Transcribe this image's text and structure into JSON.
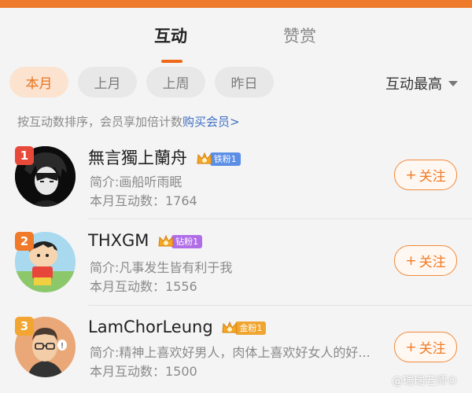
{
  "tabs": [
    {
      "label": "互动",
      "active": true
    },
    {
      "label": "赞赏",
      "active": false
    }
  ],
  "filters": [
    {
      "label": "本月",
      "active": true
    },
    {
      "label": "上月",
      "active": false
    },
    {
      "label": "上周",
      "active": false
    },
    {
      "label": "昨日",
      "active": false
    }
  ],
  "sort": {
    "label": "互动最高",
    "icon": "caret-down-icon"
  },
  "hint": {
    "text": "按互动数排序，会员享加倍计数",
    "link": "购买会员>"
  },
  "follow_label": "关注",
  "users": [
    {
      "rank": "1",
      "rank_color": "#e84a3a",
      "name": "無言獨上蘭舟",
      "fan_label": "铁粉1",
      "fan_color": "#5b8ee6",
      "bio": "简介:画船听雨眠",
      "count": "本月互动数：1764",
      "avatar": "dark-anime-avatar"
    },
    {
      "rank": "2",
      "rank_color": "#f07a2a",
      "name": "THXGM",
      "fan_label": "钻粉1",
      "fan_color": "#b06de8",
      "bio": "简介:凡事发生皆有利于我",
      "count": "本月互动数：1556",
      "avatar": "cartoon-boy-avatar"
    },
    {
      "rank": "3",
      "rank_color": "#f2a530",
      "name": "LamChorLeung",
      "fan_label": "金粉1",
      "fan_color": "#f0a530",
      "bio": "简介:精神上喜欢好男人，肉体上喜欢好女人的好...",
      "count": "本月互动数：1500",
      "avatar": "glasses-man-avatar"
    }
  ],
  "watermark": "@瑞瑞老师©"
}
